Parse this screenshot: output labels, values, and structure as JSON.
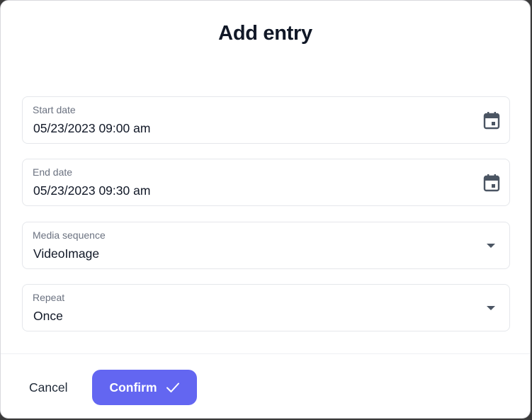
{
  "dialog": {
    "title": "Add entry"
  },
  "fields": [
    {
      "label": "Start date",
      "value": "05/23/2023 09:00 am",
      "icon": "calendar-icon"
    },
    {
      "label": "End date",
      "value": "05/23/2023 09:30 am",
      "icon": "calendar-icon"
    },
    {
      "label": "Media sequence",
      "value": "VideoImage",
      "icon": "chevron-down-icon"
    },
    {
      "label": "Repeat",
      "value": "Once",
      "icon": "chevron-down-icon"
    }
  ],
  "footer": {
    "cancel_label": "Cancel",
    "confirm_label": "Confirm",
    "confirm_icon": "check-icon"
  },
  "colors": {
    "accent": "#6366f1",
    "text": "#111827",
    "label": "#6b7280",
    "border": "#e5e7eb",
    "icon": "#4b5563"
  }
}
